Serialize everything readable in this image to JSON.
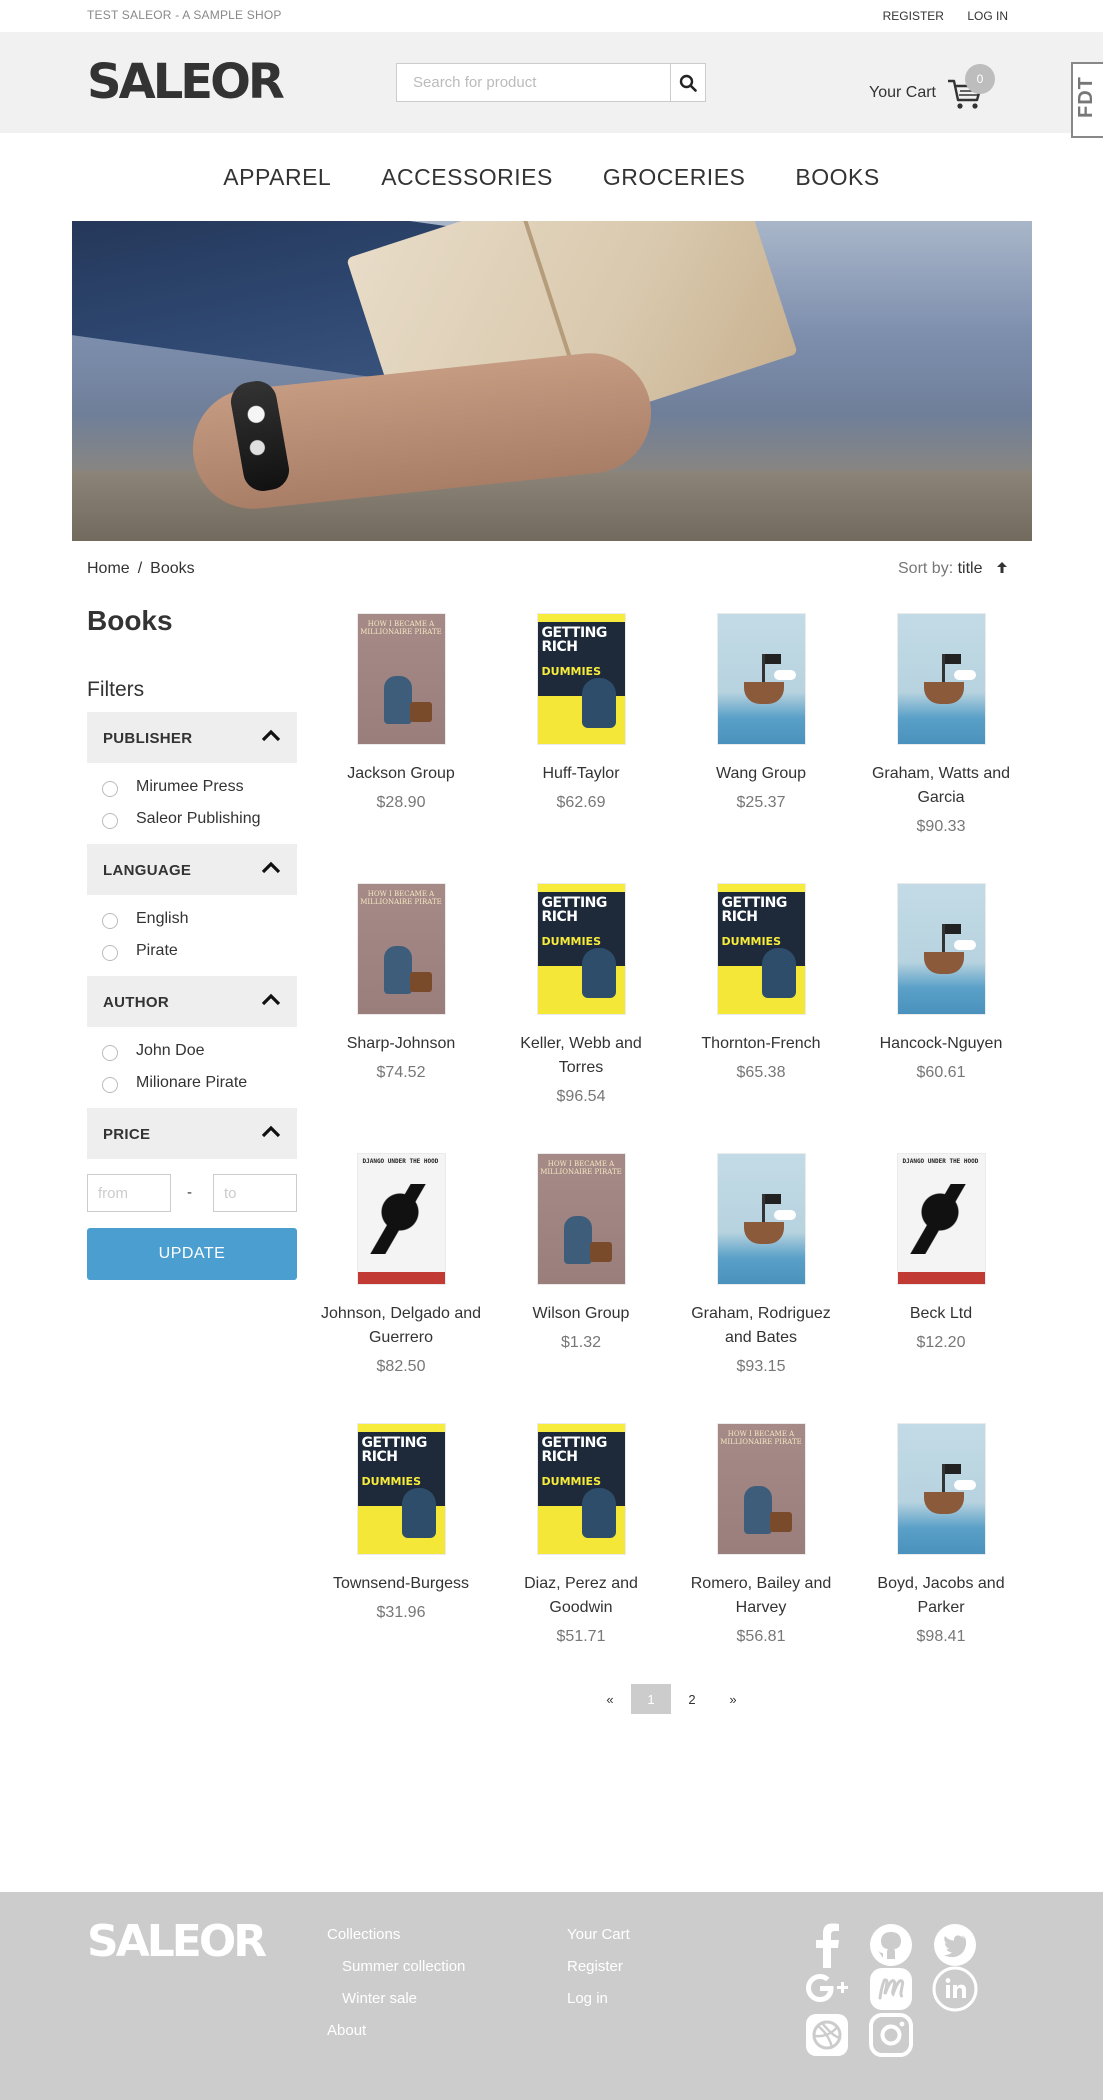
{
  "topbar": {
    "tagline": "TEST SALEOR - A SAMPLE SHOP",
    "register": "REGISTER",
    "login": "LOG IN"
  },
  "header": {
    "logo": "SALEOR",
    "search_placeholder": "Search for product",
    "cart_label": "Your Cart",
    "cart_count": "0",
    "debug_toolbar": "FDT"
  },
  "nav": [
    "APPAREL",
    "ACCESSORIES",
    "GROCERIES",
    "BOOKS"
  ],
  "breadcrumb": {
    "home": "Home",
    "sep": "/",
    "current": "Books"
  },
  "sort": {
    "label": "Sort by:",
    "value": "title"
  },
  "page_title": "Books",
  "filters": {
    "title": "Filters",
    "groups": [
      {
        "title": "PUBLISHER",
        "options": [
          "Mirumee Press",
          "Saleor Publishing"
        ]
      },
      {
        "title": "LANGUAGE",
        "options": [
          "English",
          "Pirate"
        ]
      },
      {
        "title": "AUTHOR",
        "options": [
          "John Doe",
          "Milionare Pirate"
        ]
      },
      {
        "title": "PRICE",
        "options": []
      }
    ],
    "price_from_placeholder": "from",
    "price_to_placeholder": "to",
    "price_dash": "-",
    "update_label": "UPDATE"
  },
  "products": [
    {
      "name": "Jackson Group",
      "price": "$28.90",
      "cover": "millionaire"
    },
    {
      "name": "Huff-Taylor",
      "price": "$62.69",
      "cover": "dummies"
    },
    {
      "name": "Wang Group",
      "price": "$25.37",
      "cover": "ship"
    },
    {
      "name": "Graham, Watts and Garcia",
      "price": "$90.33",
      "cover": "ship"
    },
    {
      "name": "Sharp-Johnson",
      "price": "$74.52",
      "cover": "millionaire"
    },
    {
      "name": "Keller, Webb and Torres",
      "price": "$96.54",
      "cover": "dummies"
    },
    {
      "name": "Thornton-French",
      "price": "$65.38",
      "cover": "dummies"
    },
    {
      "name": "Hancock-Nguyen",
      "price": "$60.61",
      "cover": "ship"
    },
    {
      "name": "Johnson, Delgado and Guerrero",
      "price": "$82.50",
      "cover": "hood"
    },
    {
      "name": "Wilson Group",
      "price": "$1.32",
      "cover": "millionaire"
    },
    {
      "name": "Graham, Rodriguez and Bates",
      "price": "$93.15",
      "cover": "ship"
    },
    {
      "name": "Beck Ltd",
      "price": "$12.20",
      "cover": "hood"
    },
    {
      "name": "Townsend-Burgess",
      "price": "$31.96",
      "cover": "dummies"
    },
    {
      "name": "Diaz, Perez and Goodwin",
      "price": "$51.71",
      "cover": "dummies"
    },
    {
      "name": "Romero, Bailey and Harvey",
      "price": "$56.81",
      "cover": "millionaire"
    },
    {
      "name": "Boyd, Jacobs and Parker",
      "price": "$98.41",
      "cover": "ship"
    }
  ],
  "covers": {
    "millionaire": {
      "title": "HOW I BECAME A MILLIONAIRE PIRATE"
    },
    "dummies": {
      "title": "GETTING RICH",
      "subtitle": "DUMMIES"
    },
    "hood": {
      "title": "DJANGO UNDER THE HOOD"
    }
  },
  "pagination": {
    "prev": "«",
    "pages": [
      "1",
      "2"
    ],
    "active": "1",
    "next": "»"
  },
  "footer": {
    "logo": "SALEOR",
    "col1": {
      "collections": "Collections",
      "items": [
        "Summer collection",
        "Winter sale"
      ],
      "about": "About"
    },
    "col2": [
      "Your Cart",
      "Register",
      "Log in"
    ],
    "social": [
      "facebook-icon",
      "github-icon",
      "twitter-icon",
      "google-plus-icon",
      "meetup-icon",
      "linkedin-icon",
      "dribbble-icon",
      "instagram-icon"
    ]
  },
  "colors": {
    "accent": "#4a9fd0",
    "header_bg": "#f1f1f1",
    "footer_bg": "#cccccc",
    "filter_head_bg": "#eeeeee"
  }
}
